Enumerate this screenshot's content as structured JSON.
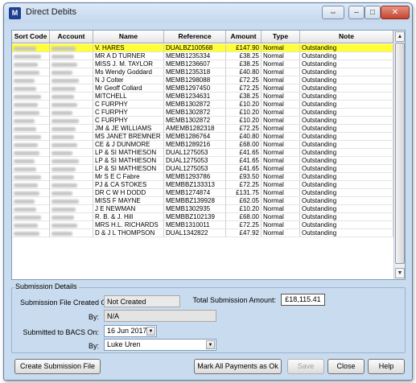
{
  "window": {
    "title": "Direct Debits",
    "app_icon_text": "M"
  },
  "grid": {
    "columns": [
      "Sort Code",
      "Account",
      "Name",
      "Reference",
      "Amount",
      "Type",
      "Note"
    ],
    "selected_index": 0,
    "rows": [
      {
        "name": "V. HARES",
        "reference": "DUALBZ100568",
        "amount": "£147.90",
        "type": "Normal",
        "note": "Outstanding"
      },
      {
        "name": "MR A D TURNER",
        "reference": "MEMB1235334",
        "amount": "£38.25",
        "type": "Normal",
        "note": "Outstanding"
      },
      {
        "name": "MISS J. M. TAYLOR",
        "reference": "MEMB1236607",
        "amount": "£38.25",
        "type": "Normal",
        "note": "Outstanding"
      },
      {
        "name": "Ms Wendy Goddard",
        "reference": "MEMB1235318",
        "amount": "£40.80",
        "type": "Normal",
        "note": "Outstanding"
      },
      {
        "name": "N J Colter",
        "reference": "MEMB1298088",
        "amount": "£72.25",
        "type": "Normal",
        "note": "Outstanding"
      },
      {
        "name": "Mr Geoff Collard",
        "reference": "MEMB1297450",
        "amount": "£72.25",
        "type": "Normal",
        "note": "Outstanding"
      },
      {
        "name": "MITCHELL",
        "reference": "MEMB1234631",
        "amount": "£38.25",
        "type": "Normal",
        "note": "Outstanding"
      },
      {
        "name": "C FURPHY",
        "reference": "MEMB1302872",
        "amount": "£10.20",
        "type": "Normal",
        "note": "Outstanding"
      },
      {
        "name": "C FURPHY",
        "reference": "MEMB1302872",
        "amount": "£10.20",
        "type": "Normal",
        "note": "Outstanding"
      },
      {
        "name": "C FURPHY",
        "reference": "MEMB1302872",
        "amount": "£10.20",
        "type": "Normal",
        "note": "Outstanding"
      },
      {
        "name": "JM & JE WILLIAMS",
        "reference": "AMEMB1282318",
        "amount": "£72.25",
        "type": "Normal",
        "note": "Outstanding"
      },
      {
        "name": "MS JANET BREMNER",
        "reference": "MEMB1286764",
        "amount": "£40.80",
        "type": "Normal",
        "note": "Outstanding"
      },
      {
        "name": "CE & J DUNMORE",
        "reference": "MEMB1289216",
        "amount": "£68.00",
        "type": "Normal",
        "note": "Outstanding"
      },
      {
        "name": "LP & SI MATHIESON",
        "reference": "DUAL1275053",
        "amount": "£41.65",
        "type": "Normal",
        "note": "Outstanding"
      },
      {
        "name": "LP & SI MATHIESON",
        "reference": "DUAL1275053",
        "amount": "£41.65",
        "type": "Normal",
        "note": "Outstanding"
      },
      {
        "name": "LP & SI MATHIESON",
        "reference": "DUAL1275053",
        "amount": "£41.65",
        "type": "Normal",
        "note": "Outstanding"
      },
      {
        "name": "Mr S E C Fabre",
        "reference": "MEMB1293786",
        "amount": "£93.50",
        "type": "Normal",
        "note": "Outstanding"
      },
      {
        "name": "PJ & CA STOKES",
        "reference": "MEMBBZ133313",
        "amount": "£72.25",
        "type": "Normal",
        "note": "Outstanding"
      },
      {
        "name": "DR C W H DODD",
        "reference": "MEMB1274874",
        "amount": "£131.75",
        "type": "Normal",
        "note": "Outstanding"
      },
      {
        "name": "MISS F MAYNE",
        "reference": "MEMBBZ139928",
        "amount": "£62.05",
        "type": "Normal",
        "note": "Outstanding"
      },
      {
        "name": "J E NEWMAN",
        "reference": "MEMB1302935",
        "amount": "£10.20",
        "type": "Normal",
        "note": "Outstanding"
      },
      {
        "name": "R. B. & J. Hill",
        "reference": "MEMBBZ102139",
        "amount": "£68.00",
        "type": "Normal",
        "note": "Outstanding"
      },
      {
        "name": "MRS H.L. RICHARDS",
        "reference": "MEMB1310011",
        "amount": "£72.25",
        "type": "Normal",
        "note": "Outstanding"
      },
      {
        "name": "D & J L THOMPSON",
        "reference": "DUAL1342822",
        "amount": "£47.92",
        "type": "Normal",
        "note": "Outstanding"
      }
    ]
  },
  "submission": {
    "group_label": "Submission Details",
    "created_on_label": "Submission File Created On:",
    "created_on_value": "Not Created",
    "by_label": "By:",
    "by_value": "N/A",
    "total_label": "Total Submission Amount:",
    "total_value": "£18,115.41",
    "submitted_label": "Submitted to BACS On:",
    "submitted_value": "16 Jun 2017",
    "by2_label": "By:",
    "by2_value": "Luke Uren"
  },
  "buttons": {
    "create": "Create Submission File",
    "mark_all": "Mark All Payments as Ok",
    "save": "Save",
    "close": "Close",
    "help": "Help"
  }
}
